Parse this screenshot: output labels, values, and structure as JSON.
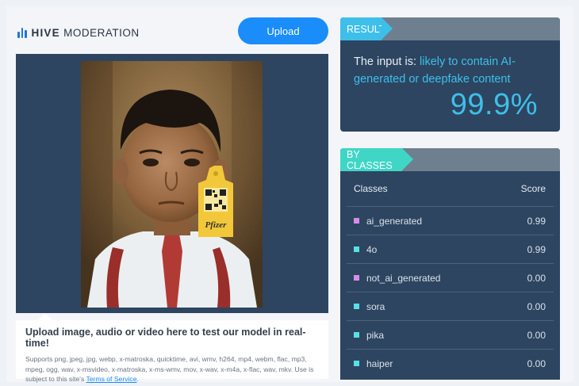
{
  "header": {
    "logo_bold": "HIVE",
    "logo_rest": "MODERATION",
    "upload_label": "Upload"
  },
  "upload_info": {
    "title": "Upload image, audio or video here to test our model in real-time!",
    "desc": "Supports png, jpeg, jpg, webp, x-matroska, quicktime, avi, wmv, h264, mp4, webm, flac, mp3, mpeg, ogg, wav, x-msvideo, x-matroska, x-ms-wmv, mov, x-wav, x-m4a, x-flac, wav, mkv. Use is subject to this site's ",
    "terms_link": "Terms of Service",
    "desc_end": "."
  },
  "photo": {
    "tag_text": "Pfizer"
  },
  "result": {
    "tab_label": "RESULT",
    "prefix": "The input is: ",
    "verdict": "likely to contain AI-generated or deepfake content",
    "score": "99.9%"
  },
  "classes": {
    "tab_label": "BY CLASSES",
    "col_classes": "Classes",
    "col_score": "Score",
    "rows": [
      {
        "label": "ai_generated",
        "score": "0.99",
        "color": "#d98be8"
      },
      {
        "label": "4o",
        "score": "0.99",
        "color": "#58e0e8"
      },
      {
        "label": "not_ai_generated",
        "score": "0.00",
        "color": "#d98be8"
      },
      {
        "label": "sora",
        "score": "0.00",
        "color": "#58e0e8"
      },
      {
        "label": "pika",
        "score": "0.00",
        "color": "#58e0e8"
      },
      {
        "label": "haiper",
        "score": "0.00",
        "color": "#58e0e8"
      }
    ]
  },
  "colors": {
    "accent": "#1a8dfb",
    "result_accent": "#3ebfea",
    "panel": "#2d4560"
  }
}
